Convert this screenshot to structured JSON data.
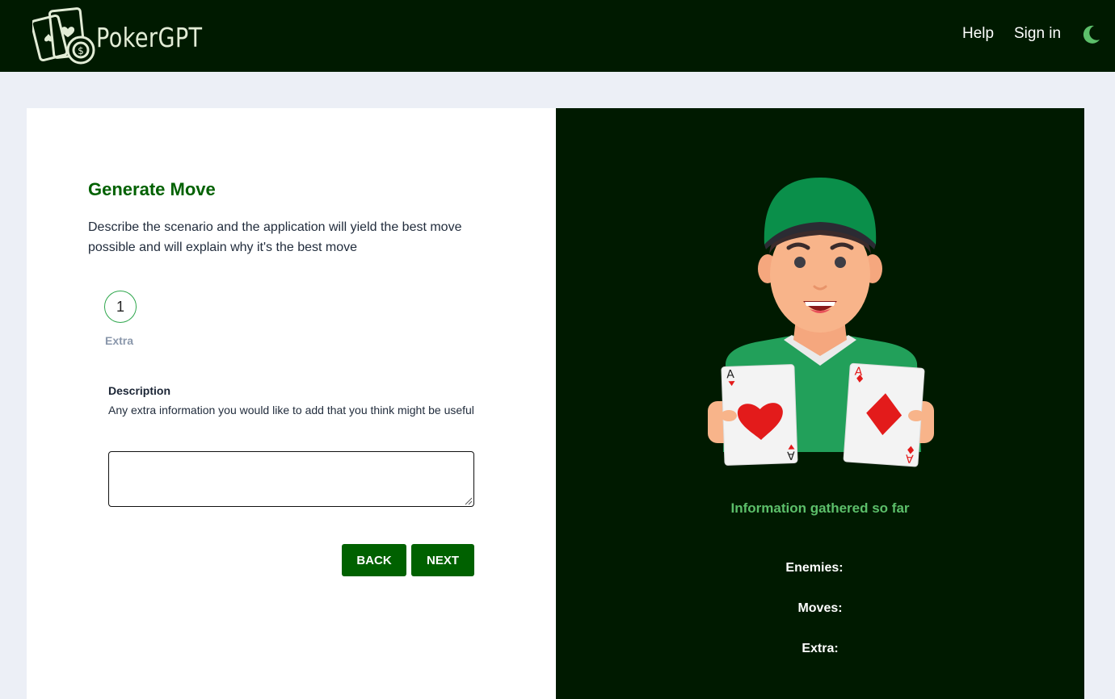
{
  "header": {
    "brand": "PokerGPT",
    "nav": {
      "help": "Help",
      "sign_in": "Sign in"
    },
    "theme_icon": "moon-icon"
  },
  "form": {
    "title": "Generate Move",
    "intro": "Describe the scenario and the application will yield the best move possible and will explain why it's the best move",
    "step": {
      "number": "1",
      "label": "Extra"
    },
    "field": {
      "label": "Description",
      "help": "Any extra information you would like to add that you think might be useful",
      "value": "",
      "placeholder": ""
    },
    "buttons": {
      "back": "BACK",
      "next": "NEXT"
    }
  },
  "summary": {
    "heading": "Information gathered so far",
    "enemies_label": "Enemies:",
    "moves_label": "Moves:",
    "extra_label": "Extra:"
  },
  "illustration": {
    "card_left": {
      "rank": "A",
      "suit": "heart-icon"
    },
    "card_right": {
      "rank": "A",
      "suit": "diamond-icon"
    }
  },
  "colors": {
    "navbar": "#001a00",
    "accent": "#006100",
    "info_heading": "#5cbf6a",
    "page_bg": "#eceff6"
  }
}
